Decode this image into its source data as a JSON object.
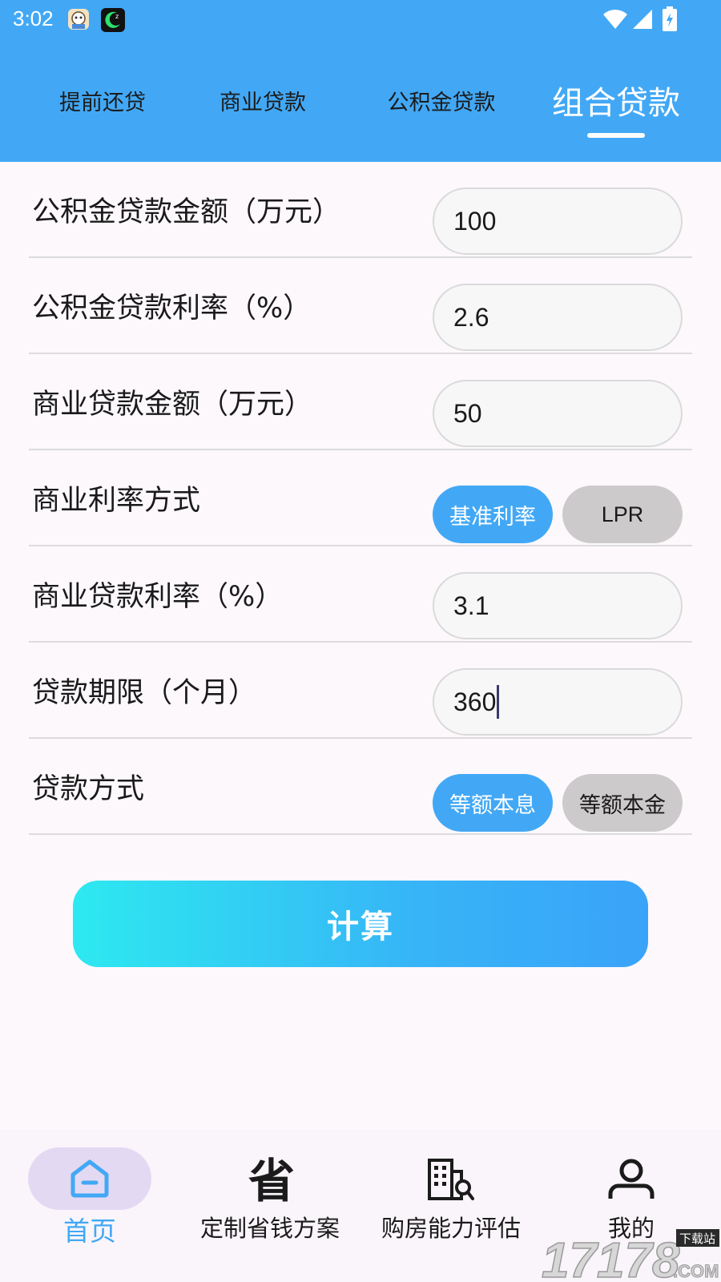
{
  "status_bar": {
    "time": "3:02"
  },
  "tabs": [
    {
      "label": "提前还贷",
      "active": false
    },
    {
      "label": "商业贷款",
      "active": false
    },
    {
      "label": "公积金贷款",
      "active": false
    },
    {
      "label": "组合贷款",
      "active": true
    }
  ],
  "form": {
    "fund_amount": {
      "label": "公积金贷款金额（万元）",
      "value": "100"
    },
    "fund_rate": {
      "label": "公积金贷款利率（%）",
      "value": "2.6"
    },
    "commercial_amount": {
      "label": "商业贷款金额（万元）",
      "value": "50"
    },
    "rate_mode": {
      "label": "商业利率方式",
      "options": [
        "基准利率",
        "LPR"
      ],
      "selected": "基准利率"
    },
    "commercial_rate": {
      "label": "商业贷款利率（%）",
      "value": "3.1"
    },
    "term": {
      "label": "贷款期限（个月）",
      "value": "360"
    },
    "repay_mode": {
      "label": "贷款方式",
      "options": [
        "等额本息",
        "等额本金"
      ],
      "selected": "等额本息"
    }
  },
  "calculate_label": "计算",
  "bottom_nav": {
    "items": [
      {
        "label": "首页",
        "icon": "home-icon",
        "active": true
      },
      {
        "label": "定制省钱方案",
        "icon": "save-money-icon",
        "glyph": "省",
        "active": false
      },
      {
        "label": "购房能力评估",
        "icon": "building-search-icon",
        "active": false
      },
      {
        "label": "我的",
        "icon": "person-icon",
        "active": false
      }
    ]
  },
  "watermark": {
    "text": "17178",
    "suffix": ".COM",
    "badge": "下载站"
  },
  "colors": {
    "primary": "#42a8f5",
    "pill_off": "#cccaca",
    "gradient_start": "#2de9f0",
    "gradient_end": "#3aa3f8",
    "nav_active_bg": "#e4d9f3"
  }
}
